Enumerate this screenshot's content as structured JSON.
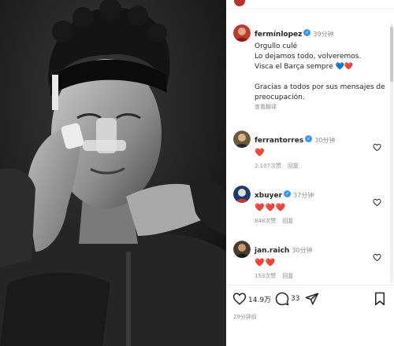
{
  "post": {
    "author": "fermínlopez",
    "time": "39分钟",
    "caption_lines": [
      "Orgullo culé",
      "Lo dejamos todo, volveremos.",
      "Visca el Barça sempre 💙❤️",
      "",
      "Gracias a todos por sus mensajes de",
      "preocupación."
    ],
    "translate": "查看翻译"
  },
  "comments": [
    {
      "user": "ferrantorres",
      "time": "30分钟",
      "text": "❤️",
      "likes": "2,107次赞",
      "reply": "回复"
    },
    {
      "user": "xbuyer",
      "time": "37分钟",
      "text": "❤️❤️❤️",
      "likes": "848次赞",
      "reply": "回复"
    },
    {
      "user": "jan.raich",
      "time": "30分钟",
      "text": "❤️❤️",
      "likes": "153次赞",
      "reply": "回复"
    }
  ],
  "actions": {
    "likes_count": "14.9万",
    "comments_count": "33"
  },
  "timestamp": "29分钟前",
  "colors": {
    "verified": "#3897f0",
    "heart_red": "#e0245e",
    "meta_gray": "#8e8e8e"
  }
}
